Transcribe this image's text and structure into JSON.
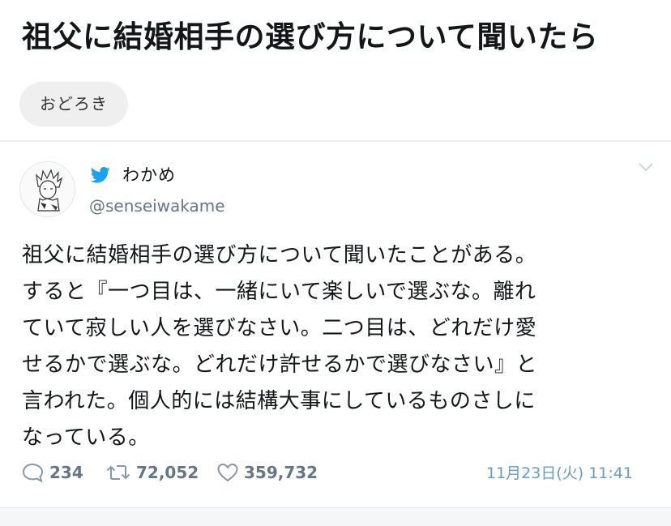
{
  "page": {
    "title": "祖父に結婚相手の選び方について聞いたら",
    "tag": "おどろき"
  },
  "tweet": {
    "display_name": "わかめ",
    "handle": "@senseiwakame",
    "text_lines": [
      "祖父に結婚相手の選び方について聞いたことがある。",
      "すると『一つ目は、一緒にいて楽しいで選ぶな。離れ",
      "ていて寂しい人を選びなさい。二つ目は、どれだけ愛",
      "せるかで選ぶな。どれだけ許せるかで選びなさい』と",
      "言われた。個人的には結構大事にしているものさしに",
      "なっている。"
    ],
    "reply_count": "234",
    "retweet_count": "72,052",
    "like_count": "359,732",
    "timestamp": "11月23日(火) 11:41",
    "icons": {
      "brand": "twitter-bird-icon",
      "menu": "chevron-down-icon",
      "reply": "reply-icon",
      "retweet": "retweet-icon",
      "like": "heart-icon"
    }
  },
  "colors": {
    "twitter_blue": "#1da1f2",
    "meta_gray": "#657786",
    "timestamp_blue": "#6a9ac8",
    "tag_bg": "#efefef"
  }
}
